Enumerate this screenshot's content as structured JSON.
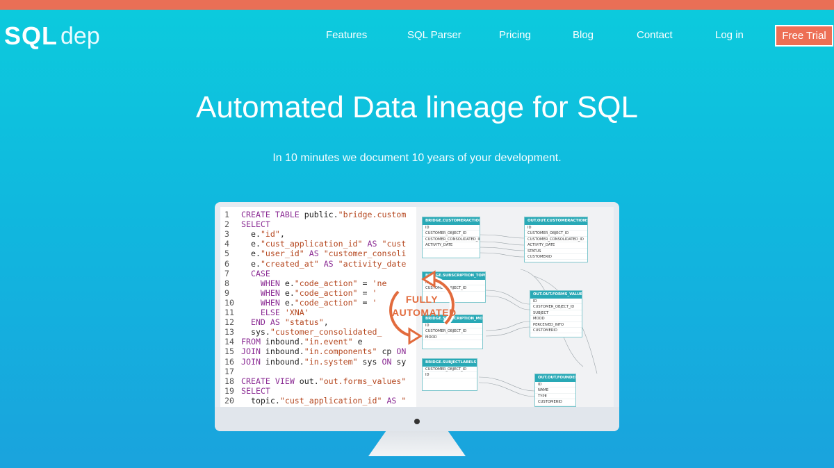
{
  "brand": {
    "logo_strong": "SQL",
    "logo_light": "dep"
  },
  "nav": {
    "items": [
      {
        "label": "Features"
      },
      {
        "label": "SQL Parser"
      },
      {
        "label": "Pricing"
      },
      {
        "label": "Blog"
      },
      {
        "label": "Contact"
      },
      {
        "label": "Log in"
      }
    ],
    "cta_label": "Free Trial"
  },
  "hero": {
    "title": "Automated Data lineage for SQL",
    "subtitle": "In 10 minutes we document 10 years of your development."
  },
  "badge": {
    "line1": "FULLY",
    "line2": "AUTOMATED"
  },
  "code": {
    "lines": [
      {
        "n": "1",
        "text": "CREATE TABLE public.\"bridge.custom"
      },
      {
        "n": "2",
        "text": "SELECT"
      },
      {
        "n": "3",
        "text": "  e.\"id\","
      },
      {
        "n": "4",
        "text": "  e.\"cust_application_id\" AS \"cust"
      },
      {
        "n": "5",
        "text": "  e.\"user_id\" AS \"customer_consoli"
      },
      {
        "n": "6",
        "text": "  e.\"created_at\" AS \"activity_date"
      },
      {
        "n": "7",
        "text": "  CASE"
      },
      {
        "n": "8",
        "text": "    WHEN e.\"code_action\" = 'ne"
      },
      {
        "n": "9",
        "text": "    WHEN e.\"code_action\" = '"
      },
      {
        "n": "10",
        "text": "    WHEN e.\"code_action\" = '"
      },
      {
        "n": "11",
        "text": "    ELSE 'XNA'"
      },
      {
        "n": "12",
        "text": "  END AS \"status\","
      },
      {
        "n": "13",
        "text": "  sys.\"customer_consolidated_"
      },
      {
        "n": "14",
        "text": "FROM inbound.\"in.event\" e"
      },
      {
        "n": "15",
        "text": "JOIN inbound.\"in.components\" cp ON"
      },
      {
        "n": "16",
        "text": "JOIN inbound.\"in.system\" sys ON sy"
      },
      {
        "n": "17",
        "text": ""
      },
      {
        "n": "18",
        "text": "CREATE VIEW out.\"out.forms_values\""
      },
      {
        "n": "19",
        "text": "SELECT"
      },
      {
        "n": "20",
        "text": "  topic.\"cust_application_id\" AS \""
      }
    ]
  },
  "diagram": {
    "tables": [
      {
        "title": "BRIDGE.CUSTOMERACTIONS",
        "rows": [
          "ID",
          "CUSTOMER_OBJECT_ID",
          "CUSTOMER_CONSOLIDATED_ID",
          "ACTIVITY_DATE"
        ]
      },
      {
        "title": "BRIDGE.SUBSCRIPTION_TOPICS",
        "rows": [
          "ID",
          "CUSTOMER_OBJECT_ID"
        ]
      },
      {
        "title": "BRIDGE.SUBSCRIPTION_MOOD",
        "rows": [
          "ID",
          "CUSTOMER_OBJECT_ID",
          "MOOD"
        ]
      },
      {
        "title": "BRIDGE.SUBJECTLABELS",
        "rows": [
          "CUSTOMER_OBJECT_ID",
          "ID"
        ]
      },
      {
        "title": "OUT.OUT.CUSTOMERACTIONS",
        "rows": [
          "ID",
          "CUSTOMER_OBJECT_ID",
          "CUSTOMER_CONSOLIDATED_ID",
          "ACTIVITY_DATE",
          "STATUS",
          "CUSTOMERID"
        ]
      },
      {
        "title": "OUT.OUT.FORMS_VALUES",
        "rows": [
          "ID",
          "CUSTOMER_OBJECT_ID",
          "SUBJECT",
          "MOOD",
          "PERCEIVED_INFO",
          "CUSTOMERID"
        ]
      },
      {
        "title": "OUT.OUT.FOUNDER",
        "rows": [
          "ID",
          "NAME",
          "TYPE",
          "CUSTOMERID"
        ]
      }
    ]
  },
  "colors": {
    "accent": "#ed6f55",
    "teal": "#29a9b6",
    "keyword": "#8a2a93",
    "string": "#b5471f"
  }
}
